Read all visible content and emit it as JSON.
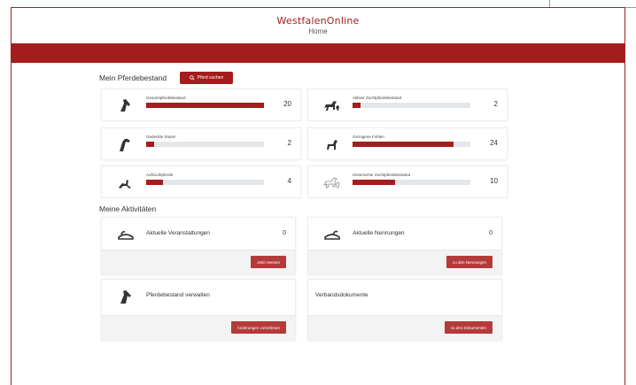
{
  "app": {
    "title": "WestfalenOnline",
    "subtitle": "Home"
  },
  "colors": {
    "accent": "#a51c1c",
    "track": "#e4e7ea"
  },
  "bestand": {
    "title": "Mein Pferdebestand",
    "search_button": "Pferd suchen",
    "search_icon": "search-icon",
    "cards": [
      {
        "label": "Gesamtpferdebestand",
        "count": "20",
        "progress": 1.0,
        "icon": "horse-head-icon"
      },
      {
        "label": "Aktiver Zuchtpferdebestand",
        "count": "2",
        "progress": 0.07,
        "icon": "mare-foal-icon"
      },
      {
        "label": "Gedeckte Stuten",
        "count": "2",
        "progress": 0.07,
        "icon": "mare-icon"
      },
      {
        "label": "Gezogene Fohlen",
        "count": "24",
        "progress": 0.86,
        "icon": "foal-icon"
      },
      {
        "label": "Aufzuchtpferde",
        "count": "4",
        "progress": 0.14,
        "icon": "young-horse-icon"
      },
      {
        "label": "Historischer Zuchtpferdebestand",
        "count": "10",
        "progress": 0.36,
        "icon": "historic-horse-icon"
      }
    ]
  },
  "aktivitaeten": {
    "title": "Meine Aktivitäten",
    "cards": [
      {
        "label": "Aktuelle Veranstaltungen",
        "count": "0",
        "button": "Jetzt nennen",
        "icon": "saddle-icon"
      },
      {
        "label": "Aktuelle Nennungen",
        "count": "0",
        "button": "zu den Nennungen",
        "icon": "saddle-icon"
      },
      {
        "label": "Pferdebestand verwalten",
        "count": "",
        "button": "Änderungen vornehmen",
        "icon": "horse-head-icon"
      },
      {
        "label": "Verbandsdokumente",
        "count": "",
        "button": "zu den Dokumenten",
        "icon": ""
      }
    ]
  }
}
